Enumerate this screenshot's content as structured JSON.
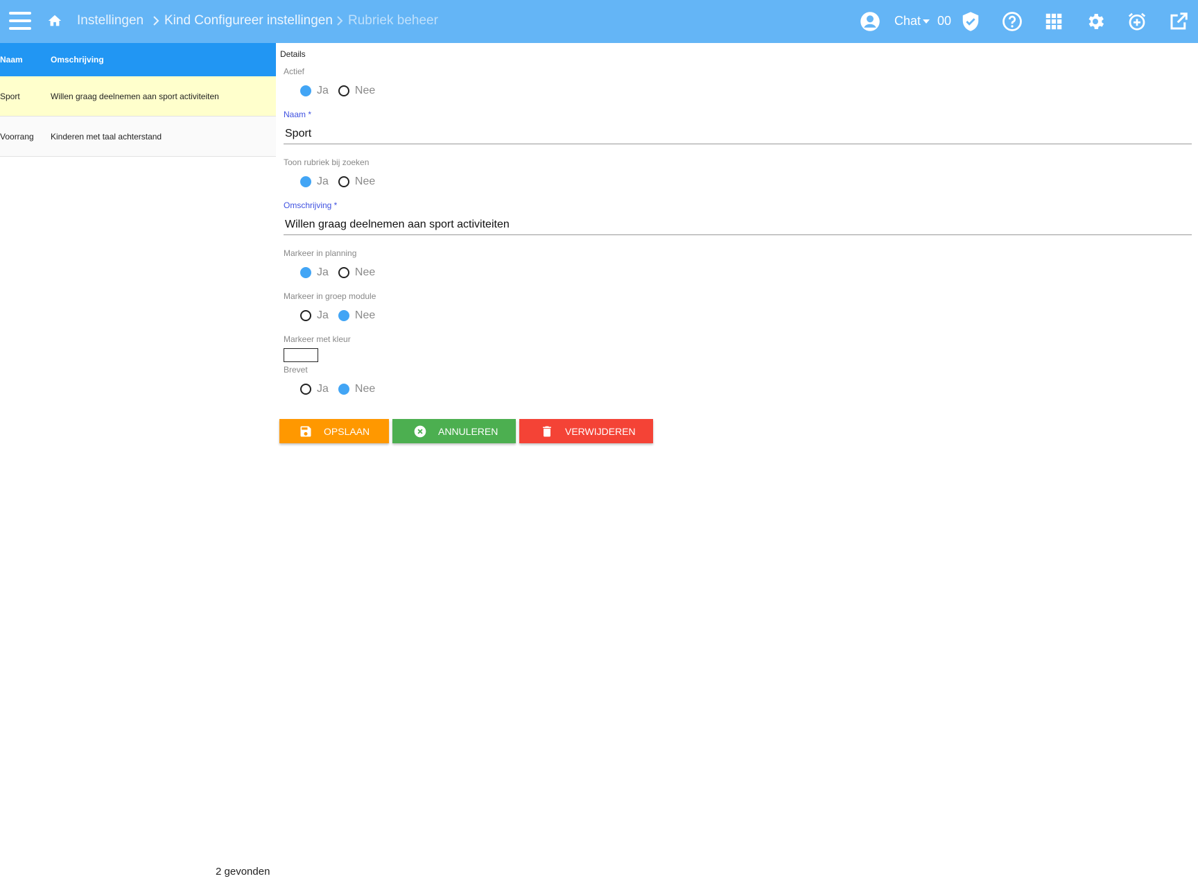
{
  "topbar": {
    "breadcrumb": [
      "Instellingen",
      "Kind Configureer instellingen",
      "Rubriek beheer"
    ],
    "chat_label": "Chat",
    "chat_count": "00"
  },
  "list": {
    "headers": {
      "naam": "Naam",
      "omschrijving": "Omschrijving"
    },
    "rows": [
      {
        "naam": "Sport",
        "omschrijving": "Willen graag deelnemen aan sport activiteiten",
        "selected": true
      },
      {
        "naam": "Voorrang",
        "omschrijving": "Kinderen met taal achterstand",
        "selected": false
      }
    ],
    "found_text": "2 gevonden"
  },
  "details": {
    "title": "Details",
    "options": {
      "yes": "Ja",
      "no": "Nee"
    },
    "actief": {
      "label": "Actief",
      "value": "Ja"
    },
    "naam": {
      "label": "Naam *",
      "value": "Sport"
    },
    "toon_rubriek": {
      "label": "Toon rubriek bij zoeken",
      "value": "Ja"
    },
    "omschrijving": {
      "label": "Omschrijving *",
      "value": "Willen graag deelnemen aan sport activiteiten"
    },
    "markeer_planning": {
      "label": "Markeer in planning",
      "value": "Ja"
    },
    "markeer_groep": {
      "label": "Markeer in groep module",
      "value": "Nee"
    },
    "markeer_kleur": {
      "label": "Markeer met kleur",
      "value": "#ffffff"
    },
    "brevet": {
      "label": "Brevet",
      "value": "Nee"
    }
  },
  "buttons": {
    "save": "OPSLAAN",
    "cancel": "ANNULEREN",
    "delete": "VERWIJDEREN"
  },
  "colors": {
    "topbar": "#64b5f6",
    "list_header": "#2196f3",
    "selected_row": "#ffffcc",
    "radio_on": "#42a5f5",
    "save": "#ff9800",
    "cancel": "#4caf50",
    "delete": "#f44336"
  },
  "icons": [
    "menu-icon",
    "home-icon",
    "account-icon",
    "shield-check-icon",
    "help-icon",
    "apps-grid-icon",
    "gear-icon",
    "alarm-add-icon",
    "open-external-icon",
    "save-icon",
    "cancel-circle-icon",
    "trash-icon"
  ]
}
